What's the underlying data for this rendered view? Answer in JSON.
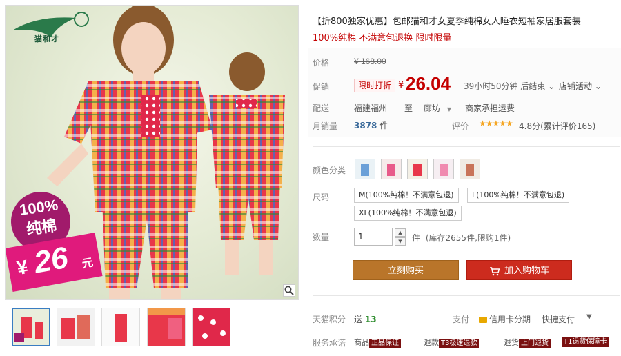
{
  "main_image": {
    "badge_percent": "100%",
    "badge_material": "纯棉",
    "badge_currency": "¥",
    "badge_price": "26",
    "badge_unit": "元",
    "logo_text": "猫和才"
  },
  "product": {
    "title": "【折800独家优惠】包邮猫和才女夏季纯棉女人睡衣短袖家居服套装",
    "subtitle": "100%纯棉 不满意包退换 限时限量"
  },
  "price": {
    "label": "价格",
    "original": "¥ 168.00",
    "promo_label": "促销",
    "promo_tag": "限时打折",
    "currency": "¥",
    "current": "26.04",
    "countdown": "39小时50分钟 后结束",
    "store_promo": "店铺活动"
  },
  "shipping": {
    "label": "配送",
    "from": "福建福州",
    "to_word": "至",
    "to": "廊坊",
    "fee": "商家承担运费"
  },
  "sales": {
    "label": "月销量",
    "count": "3878",
    "unit": "件",
    "review_label": "评价",
    "stars": "★★★★★",
    "score_text": "4.8分(累计评价165)"
  },
  "color": {
    "label": "颜色分类",
    "options": [
      "1",
      "2",
      "3",
      "4",
      "5"
    ]
  },
  "size": {
    "label": "尺码",
    "options": [
      "M(100%纯棉！不满意包退)",
      "L(100%纯棉！不满意包退)",
      "XL(100%纯棉！不满意包退)"
    ]
  },
  "quantity": {
    "label": "数量",
    "value": "1",
    "unit": "件",
    "stock": "(库存2655件,限购1件)"
  },
  "actions": {
    "buy_now": "立刻购买",
    "add_cart": "加入购物车"
  },
  "extras": {
    "points_label": "天猫积分",
    "points_prefix": "送",
    "points_value": "13",
    "pay_label": "支付",
    "pay_credit": "信用卡分期",
    "pay_fast": "快捷支付",
    "service_label": "服务承诺",
    "services": [
      {
        "pre": "商品",
        "tag": "正品保证"
      },
      {
        "pre": "退款",
        "tag": "T3极速退款"
      },
      {
        "pre": "退货",
        "tag": "上门退货"
      },
      {
        "pre": "",
        "tag": "T1退货保障卡"
      }
    ]
  },
  "colors": {
    "accent_red": "#c40000",
    "buy_button": "#b9752a",
    "cart_button": "#cc2b1e",
    "badge_pink": "#e01a7c"
  }
}
